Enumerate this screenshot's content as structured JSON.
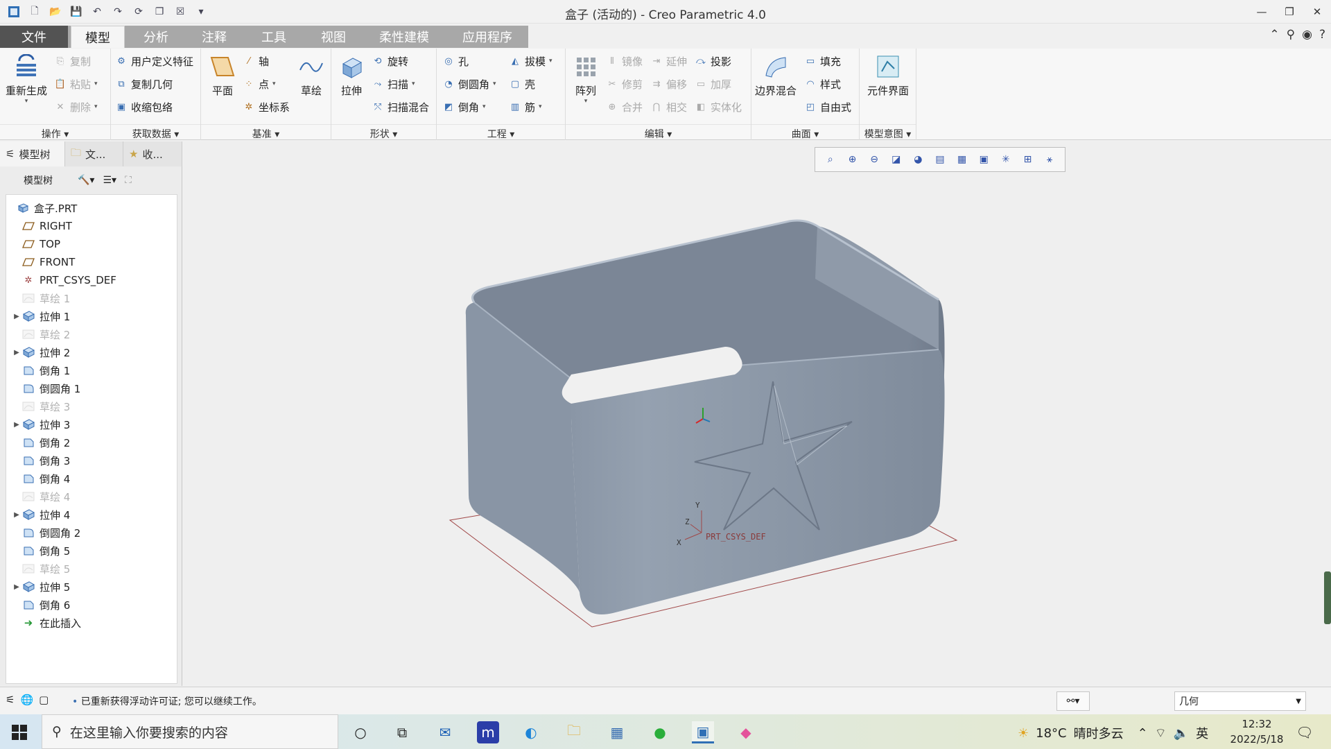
{
  "window": {
    "title": "盒子 (活动的) - Creo Parametric 4.0"
  },
  "tabs": [
    {
      "label": "文件"
    },
    {
      "label": "模型"
    },
    {
      "label": "分析"
    },
    {
      "label": "注释"
    },
    {
      "label": "工具"
    },
    {
      "label": "视图"
    },
    {
      "label": "柔性建模"
    },
    {
      "label": "应用程序"
    }
  ],
  "ribbon": {
    "operations": {
      "label": "操作",
      "regenerate": "重新生成",
      "copy": "复制",
      "paste": "粘贴",
      "delete": "删除"
    },
    "getdata": {
      "label": "获取数据",
      "udf": "用户定义特征",
      "copygeom": "复制几何",
      "shrinkwrap": "收缩包络"
    },
    "datum": {
      "label": "基准",
      "plane": "平面",
      "axis": "轴",
      "point": "点",
      "csys": "坐标系",
      "sketch": "草绘"
    },
    "shapes": {
      "label": "形状",
      "extrude": "拉伸",
      "revolve": "旋转",
      "sweep": "扫描",
      "sweptblend": "扫描混合"
    },
    "engineering": {
      "label": "工程",
      "hole": "孔",
      "round": "倒圆角",
      "chamfer": "倒角",
      "draft": "拔模",
      "shell": "壳",
      "rib": "筋"
    },
    "editing": {
      "label": "编辑",
      "pattern": "阵列",
      "mirror": "镜像",
      "extend": "延伸",
      "project": "投影",
      "trim": "修剪",
      "offset": "偏移",
      "thicken": "加厚",
      "merge": "合并",
      "intersect": "相交",
      "solidify": "实体化"
    },
    "surfaces": {
      "label": "曲面",
      "boundary": "边界混合",
      "fill": "填充",
      "style": "样式",
      "freestyle": "自由式"
    },
    "intent": {
      "label": "模型意图",
      "component": "元件界面"
    }
  },
  "panel": {
    "tabs": [
      "模型树",
      "文...",
      "收..."
    ],
    "toolbar_label": "模型树",
    "tree": [
      {
        "label": "盒子.PRT",
        "icon": "part-icon",
        "expand": false,
        "dim": false,
        "indent": 0
      },
      {
        "label": "RIGHT",
        "icon": "datum-plane-icon",
        "expand": false,
        "dim": false,
        "indent": 1
      },
      {
        "label": "TOP",
        "icon": "datum-plane-icon",
        "expand": false,
        "dim": false,
        "indent": 1
      },
      {
        "label": "FRONT",
        "icon": "datum-plane-icon",
        "expand": false,
        "dim": false,
        "indent": 1
      },
      {
        "label": "PRT_CSYS_DEF",
        "icon": "csys-icon",
        "expand": false,
        "dim": false,
        "indent": 1
      },
      {
        "label": "草绘 1",
        "icon": "sketch-icon",
        "expand": false,
        "dim": true,
        "indent": 1
      },
      {
        "label": "拉伸 1",
        "icon": "extrude-icon",
        "expand": true,
        "dim": false,
        "indent": 1
      },
      {
        "label": "草绘 2",
        "icon": "sketch-icon",
        "expand": false,
        "dim": true,
        "indent": 1
      },
      {
        "label": "拉伸 2",
        "icon": "extrude-icon",
        "expand": true,
        "dim": false,
        "indent": 1
      },
      {
        "label": "倒角 1",
        "icon": "chamfer-icon",
        "expand": false,
        "dim": false,
        "indent": 1
      },
      {
        "label": "倒圆角 1",
        "icon": "round-icon",
        "expand": false,
        "dim": false,
        "indent": 1
      },
      {
        "label": "草绘 3",
        "icon": "sketch-icon",
        "expand": false,
        "dim": true,
        "indent": 1
      },
      {
        "label": "拉伸 3",
        "icon": "extrude-icon",
        "expand": true,
        "dim": false,
        "indent": 1
      },
      {
        "label": "倒角 2",
        "icon": "chamfer-icon",
        "expand": false,
        "dim": false,
        "indent": 1
      },
      {
        "label": "倒角 3",
        "icon": "chamfer-icon",
        "expand": false,
        "dim": false,
        "indent": 1
      },
      {
        "label": "倒角 4",
        "icon": "chamfer-icon",
        "expand": false,
        "dim": false,
        "indent": 1
      },
      {
        "label": "草绘 4",
        "icon": "sketch-icon",
        "expand": false,
        "dim": true,
        "indent": 1
      },
      {
        "label": "拉伸 4",
        "icon": "extrude-icon",
        "expand": true,
        "dim": false,
        "indent": 1
      },
      {
        "label": "倒圆角 2",
        "icon": "round-icon",
        "expand": false,
        "dim": false,
        "indent": 1
      },
      {
        "label": "倒角 5",
        "icon": "chamfer-icon",
        "expand": false,
        "dim": false,
        "indent": 1
      },
      {
        "label": "草绘 5",
        "icon": "sketch-icon",
        "expand": false,
        "dim": true,
        "indent": 1
      },
      {
        "label": "拉伸 5",
        "icon": "extrude-icon",
        "expand": true,
        "dim": false,
        "indent": 1
      },
      {
        "label": "倒角 6",
        "icon": "chamfer-icon",
        "expand": false,
        "dim": false,
        "indent": 1
      },
      {
        "label": "在此插入",
        "icon": "insert-here-icon",
        "expand": false,
        "dim": false,
        "indent": 1
      }
    ]
  },
  "viewport": {
    "csys_label": "PRT_CSYS_DEF",
    "axis_x": "X",
    "axis_y": "Y",
    "axis_z": "Z",
    "model_color": "#8e99a8"
  },
  "status": {
    "message": "已重新获得浮动许可证; 您可以继续工作。",
    "filter_value": "几何"
  },
  "taskbar": {
    "search_placeholder": "在这里输入你要搜索的内容",
    "weather_temp": "18°C",
    "weather_text": "晴时多云",
    "ime": "英",
    "time": "12:32",
    "date": "2022/5/18"
  }
}
